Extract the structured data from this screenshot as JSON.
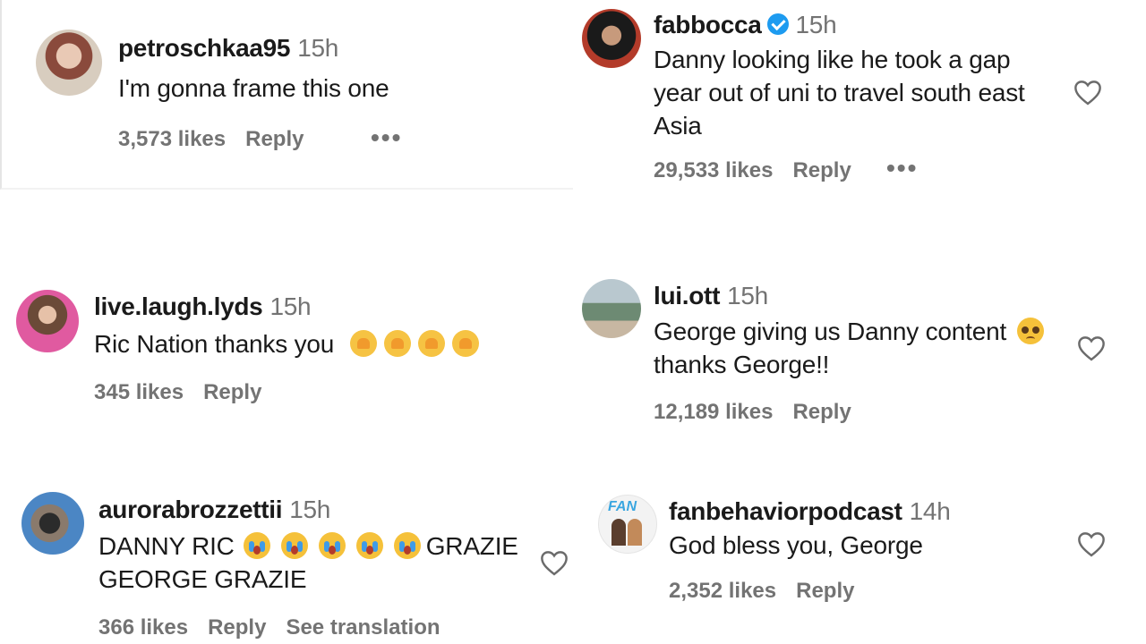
{
  "comments": [
    {
      "username": "petroschkaa95",
      "time": "15h",
      "text_lines": [
        "I'm gonna frame this one"
      ],
      "likes": "3,573 likes",
      "reply": "Reply",
      "more": "•••"
    },
    {
      "username": "fabbocca",
      "verified": true,
      "time": "15h",
      "text_lines": [
        "Danny looking like he took a gap",
        "year out of uni to travel south east",
        "Asia"
      ],
      "likes": "29,533 likes",
      "reply": "Reply",
      "more": "•••"
    },
    {
      "username": "live.laugh.lyds",
      "time": "15h",
      "text": "Ric Nation thanks you",
      "emojis": [
        "heart-hands-emoji",
        "heart-hands-emoji",
        "heart-hands-emoji",
        "heart-hands-emoji"
      ],
      "likes": "345 likes",
      "reply": "Reply"
    },
    {
      "username": "lui.ott",
      "time": "15h",
      "text_lines": [
        "George giving us Danny content",
        "thanks George!!"
      ],
      "emojis": [
        "pleading-face-emoji"
      ],
      "likes": "12,189 likes",
      "reply": "Reply"
    },
    {
      "username": "aurorabrozzettii",
      "time": "15h",
      "text_start": "DANNY RIC",
      "emojis": [
        "crying-face-emoji",
        "crying-face-emoji",
        "crying-face-emoji",
        "crying-face-emoji",
        "crying-face-emoji"
      ],
      "text_end": "GRAZIE",
      "text_line2": "GEORGE GRAZIE",
      "likes": "366 likes",
      "reply": "Reply",
      "translate": "See translation"
    },
    {
      "username": "fanbehaviorpodcast",
      "time": "14h",
      "text_lines": [
        "God bless you, George"
      ],
      "likes": "2,352 likes",
      "reply": "Reply",
      "avatar_text": "FAN"
    }
  ],
  "icons": {
    "like": "heart-outline-icon",
    "more": "more-dots-icon"
  },
  "colors": {
    "text": "#1a1a1a",
    "muted": "#737373",
    "verified": "#1d9bf0"
  }
}
